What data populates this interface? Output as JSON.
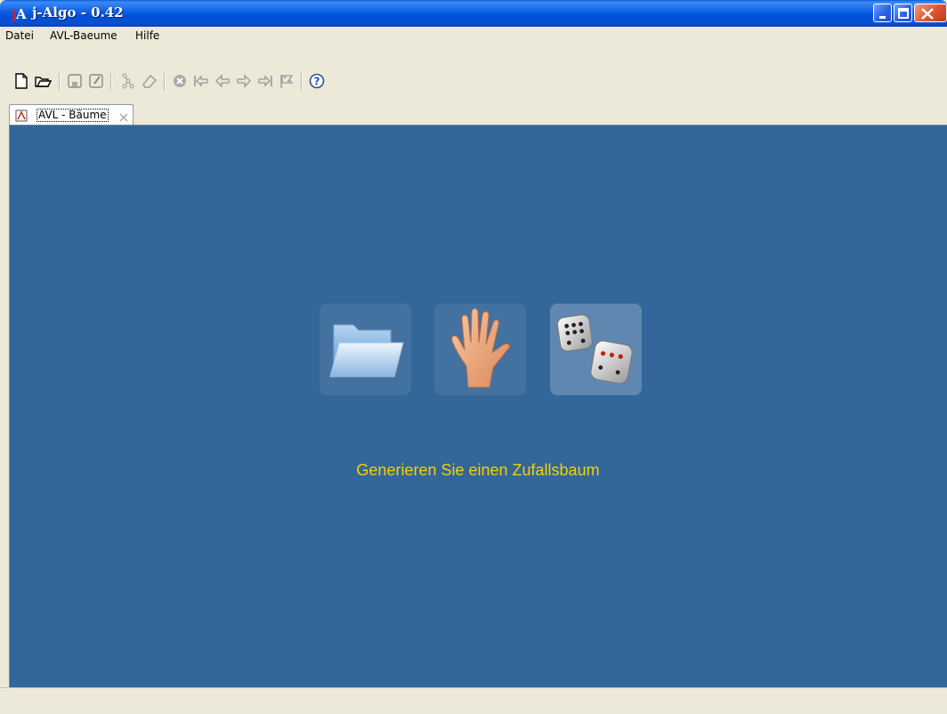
{
  "window": {
    "title": "j-Algo - 0.42",
    "logo_text": "jA"
  },
  "menu": {
    "items": [
      {
        "label": "Datei"
      },
      {
        "label": "AVL-Baeume"
      },
      {
        "label": "Hilfe"
      }
    ]
  },
  "toolbar": {
    "buttons": [
      {
        "icon": "new-document-icon"
      },
      {
        "icon": "open-folder-icon"
      },
      {
        "icon": "save-icon"
      },
      {
        "icon": "save-as-icon"
      },
      {
        "icon": "tree-icon"
      },
      {
        "icon": "eraser-icon"
      },
      {
        "icon": "stop-icon"
      },
      {
        "icon": "first-step-icon"
      },
      {
        "icon": "step-back-icon"
      },
      {
        "icon": "step-forward-icon"
      },
      {
        "icon": "last-step-icon"
      },
      {
        "icon": "finish-flag-icon"
      },
      {
        "icon": "help-icon"
      }
    ]
  },
  "tab": {
    "label": "AVL - Bäume"
  },
  "main": {
    "options": [
      {
        "icon": "open-folder-icon",
        "active": false
      },
      {
        "icon": "hand-icon",
        "active": false
      },
      {
        "icon": "dice-icon",
        "active": true
      }
    ],
    "hint": "Generieren Sie einen Zufallsbaum"
  },
  "colors": {
    "panel_bg": "#336699",
    "hint_text": "#f5d100",
    "titlebar": "#0b5ee4"
  }
}
